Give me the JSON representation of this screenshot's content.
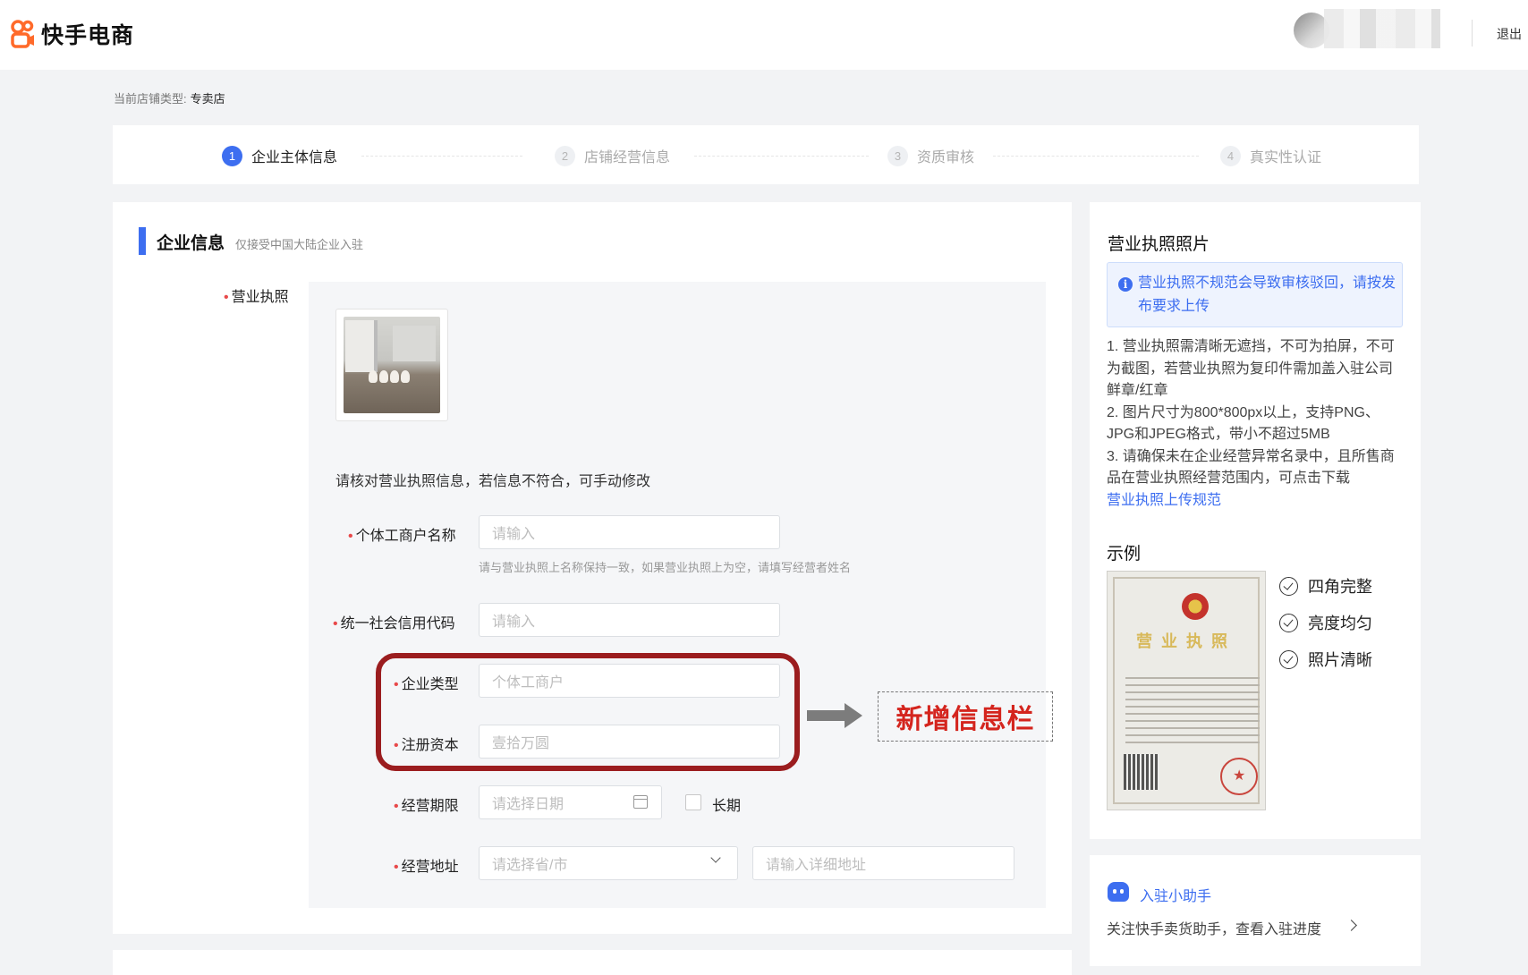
{
  "brand": {
    "name": "快手电商",
    "accent": "#3d6ef0",
    "logo_color": "#ff6a2a"
  },
  "header": {
    "logout": "退出"
  },
  "store_type": {
    "label": "当前店铺类型:",
    "value": "专卖店"
  },
  "steps": [
    {
      "num": "1",
      "label": "企业主体信息",
      "active": true
    },
    {
      "num": "2",
      "label": "店铺经营信息",
      "active": false
    },
    {
      "num": "3",
      "label": "资质审核",
      "active": false
    },
    {
      "num": "4",
      "label": "真实性认证",
      "active": false
    }
  ],
  "section": {
    "title": "企业信息",
    "subtitle": "仅接受中国大陆企业入驻"
  },
  "form": {
    "license_label": "营业执照",
    "verify_text": "请核对营业执照信息，若信息不符合，可手动修改",
    "name": {
      "label": "个体工商户名称",
      "placeholder": "请输入",
      "hint": "请与营业执照上名称保持一致，如果营业执照上为空，请填写经营者姓名"
    },
    "credit_code": {
      "label": "统一社会信用代码",
      "placeholder": "请输入"
    },
    "company_type": {
      "label": "企业类型",
      "placeholder": "个体工商户"
    },
    "capital": {
      "label": "注册资本",
      "placeholder": "壹拾万圆"
    },
    "term": {
      "label": "经营期限",
      "placeholder": "请选择日期",
      "long_term": "长期"
    },
    "address": {
      "label": "经营地址",
      "province_placeholder": "请选择省/市",
      "detail_placeholder": "请输入详细地址"
    }
  },
  "annotation": {
    "text": "新增信息栏",
    "color": "#d4251e",
    "frame_color": "#9b1d1f"
  },
  "sidebar": {
    "title": "营业执照照片",
    "notice": "营业执照不规范会导致审核驳回，请按发布要求上传",
    "rules": [
      "1. 营业执照需清晰无遮挡，不可为拍屏，不可为截图，若营业执照为复印件需加盖入驻公司鲜章/红章",
      "2. 图片尺寸为800*800px以上，支持PNG、JPG和JPEG格式，带小不超过5MB",
      "3. 请确保未在企业经营异常名录中，且所售商品在营业执照经营范围内，可点击下载"
    ],
    "rules_link": "营业执照上传规范",
    "example_title": "示例",
    "cert_title": "营业执照",
    "checks": [
      "四角完整",
      "亮度均匀",
      "照片清晰"
    ]
  },
  "helper": {
    "title": "入驻小助手",
    "desc": "关注快手卖货助手，查看入驻进度"
  }
}
